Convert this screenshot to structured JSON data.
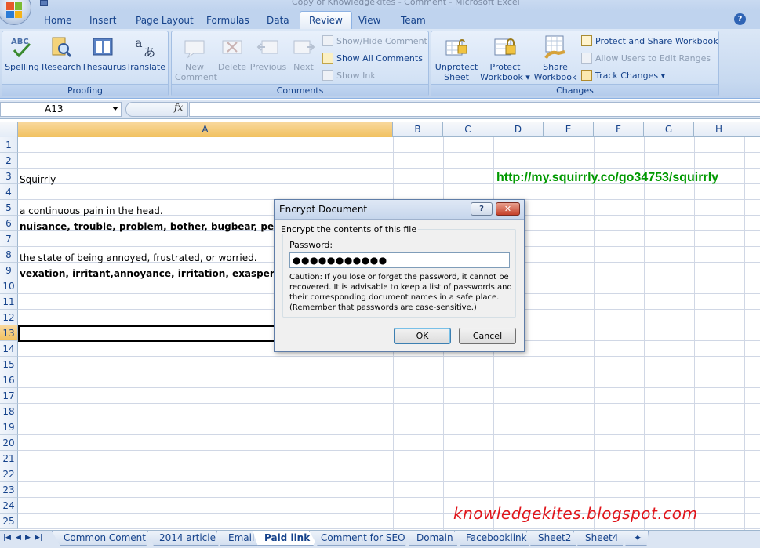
{
  "window": {
    "title": "Copy of Knowledgekites - Comment - Microsoft Excel"
  },
  "ribbon_tabs": [
    "Home",
    "Insert",
    "Page Layout",
    "Formulas",
    "Data",
    "Review",
    "View",
    "Team"
  ],
  "active_tab": "Review",
  "groups": {
    "proofing": {
      "label": "Proofing",
      "buttons": [
        "Spelling",
        "Research",
        "Thesaurus",
        "Translate"
      ]
    },
    "comments": {
      "label": "Comments",
      "new_comment": [
        "New",
        "Comment"
      ],
      "delete": "Delete",
      "previous": "Previous",
      "next": "Next",
      "show_hide": "Show/Hide Comment",
      "show_all": "Show All Comments",
      "show_ink": "Show Ink"
    },
    "changes": {
      "label": "Changes",
      "unprotect_sheet": [
        "Unprotect",
        "Sheet"
      ],
      "protect_workbook": [
        "Protect",
        "Workbook"
      ],
      "share_workbook": [
        "Share",
        "Workbook"
      ],
      "protect_share": "Protect and Share Workbook",
      "allow_users": "Allow Users to Edit Ranges",
      "track_changes": "Track Changes"
    }
  },
  "formula_bar": {
    "name_box": "A13",
    "fx": "fx",
    "formula": ""
  },
  "columns": [
    "A",
    "B",
    "C",
    "D",
    "E",
    "F",
    "G",
    "H"
  ],
  "rows": [
    "1",
    "2",
    "3",
    "4",
    "5",
    "6",
    "7",
    "8",
    "9",
    "10",
    "11",
    "12",
    "13",
    "14",
    "15",
    "16",
    "17",
    "18",
    "19",
    "20",
    "21",
    "22",
    "23",
    "24",
    "25"
  ],
  "selected_row": "13",
  "selected_column": "A",
  "cells": {
    "A3": "Squirrly",
    "A5": "a continuous pain in the head.",
    "A6": "nuisance, trouble, problem, bother, bugbear, pest, w",
    "A8": "the state of being annoyed, frustrated, or worried.",
    "A9": "vexation, irritant,annoyance, irritation, exasperation",
    "D3": "http://my.squirrly.co/go34753/squirrly"
  },
  "sheet_tabs": [
    "Common Coment",
    "2014 article",
    "Email",
    "Paid link",
    "Comment for SEO",
    "Domain",
    "Facebooklink",
    "Sheet2",
    "Sheet4"
  ],
  "active_sheet": "Paid link",
  "watermark": "knowledgekites.blogspot.com",
  "dialog": {
    "title": "Encrypt Document",
    "help": "?",
    "close": "✕",
    "legend": "Encrypt the contents of this file",
    "password_label": "Password:",
    "password_value": "●●●●●●●●●●●",
    "caution": "Caution: If you lose or forget the password, it cannot be recovered. It is advisable to keep a list of passwords and their corresponding document names in a safe place. (Remember that passwords are case-sensitive.)",
    "ok": "OK",
    "cancel": "Cancel"
  },
  "colors": {
    "accent": "#15428b",
    "selection": "#f1c15f",
    "link": "#009900",
    "watermark": "#e0151b"
  }
}
